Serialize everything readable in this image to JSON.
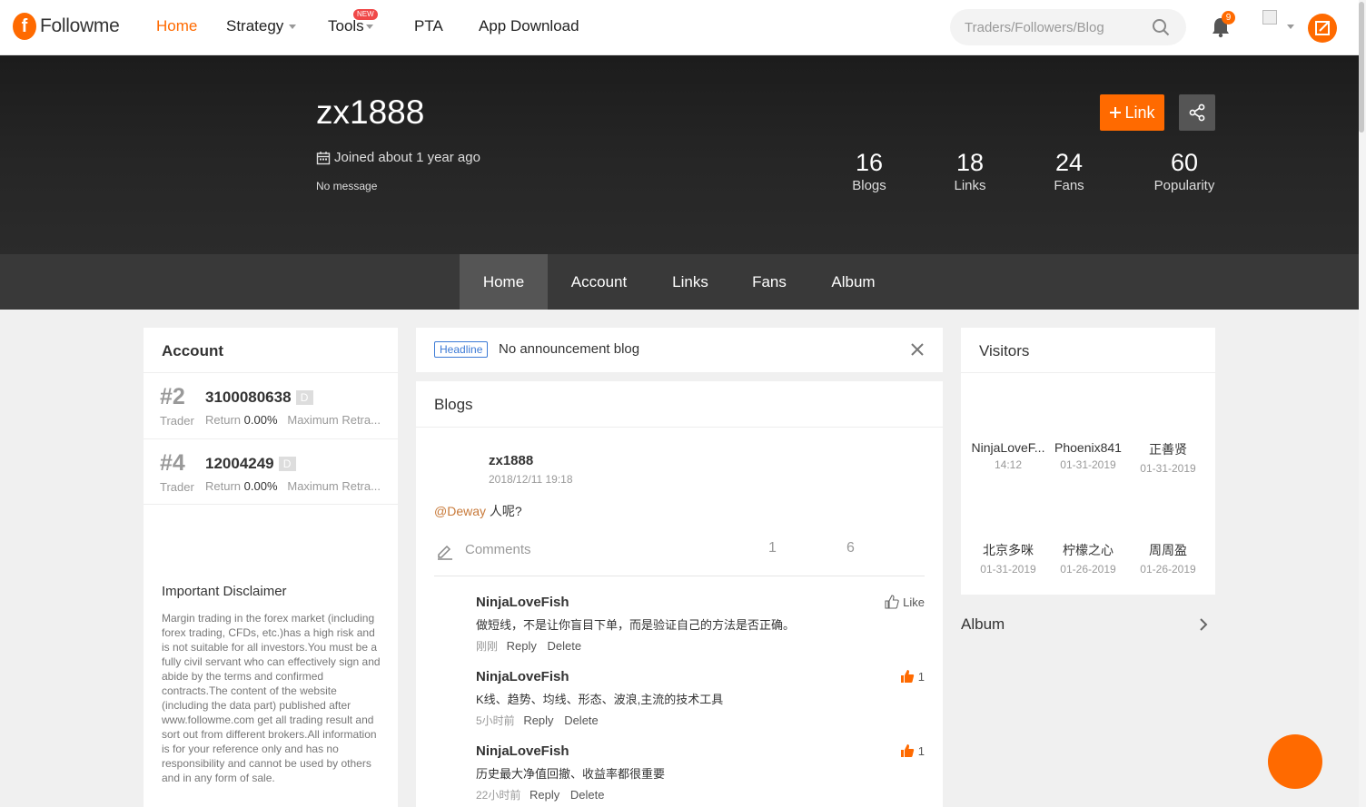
{
  "topnav": {
    "brand": "Followme",
    "logo_letter": "f",
    "items": [
      {
        "label": "Home",
        "active": true
      },
      {
        "label": "Strategy"
      },
      {
        "label": "Tools"
      },
      {
        "label": "PTA"
      },
      {
        "label": "App Download"
      }
    ],
    "tools_badge": "NEW",
    "search_placeholder": "Traders/Followers/Blog",
    "notification_count": "9",
    "accent_color": "#ff6a00"
  },
  "profile": {
    "username": "zx1888",
    "joined": "Joined about 1 year ago",
    "message": "No message",
    "link_button": "Link",
    "stats": [
      {
        "value": "16",
        "label": "Blogs"
      },
      {
        "value": "18",
        "label": "Links"
      },
      {
        "value": "24",
        "label": "Fans"
      },
      {
        "value": "60",
        "label": "Popularity"
      }
    ]
  },
  "tabs": [
    {
      "label": "Home",
      "active": true
    },
    {
      "label": "Account"
    },
    {
      "label": "Links"
    },
    {
      "label": "Fans"
    },
    {
      "label": "Album"
    }
  ],
  "account_panel": {
    "title": "Account",
    "accounts": [
      {
        "rank": "#2",
        "role": "Trader",
        "number": "3100080638",
        "badge": "D",
        "return_label": "Return",
        "return_value": "0.00%",
        "retra_label": "Maximum Retra..."
      },
      {
        "rank": "#4",
        "role": "Trader",
        "number": "12004249",
        "badge": "D",
        "return_label": "Return",
        "return_value": "0.00%",
        "retra_label": "Maximum Retra..."
      }
    ],
    "disclaimer_title": "Important Disclaimer",
    "disclaimer_text": "Margin trading in the forex market (including forex trading, CFDs, etc.)has a high risk and is not suitable for all investors.You must be a fully civil servant who can effectively sign and abide by the terms and confirmed contracts.The content of the website (including the data part) published after www.followme.com get all trading result and sort out from different brokers.All information is for your reference only and has no responsibility and cannot be used by others and in any form of sale."
  },
  "headline": {
    "tag": "Headline",
    "text": "No announcement blog"
  },
  "blogs": {
    "title": "Blogs",
    "post": {
      "author": "zx1888",
      "time": "2018/12/11 19:18",
      "mention": "@Deway",
      "body": " 人呢?",
      "comments_label": "Comments",
      "count_a": "1",
      "count_b": "6"
    },
    "comments": [
      {
        "name": "NinjaLoveFish",
        "text": "做短线，不是让你盲目下单，而是验证自己的方法是否正确。",
        "time": "刚刚",
        "reply": "Reply",
        "delete": "Delete",
        "like_label": "Like",
        "liked": false
      },
      {
        "name": "NinjaLoveFish",
        "text": "K线、趋势、均线、形态、波浪,主流的技术工具",
        "time": "5小时前",
        "reply": "Reply",
        "delete": "Delete",
        "like_label": "1",
        "liked": true
      },
      {
        "name": "NinjaLoveFish",
        "text": "历史最大净值回撤、收益率都很重要",
        "time": "22小时前",
        "reply": "Reply",
        "delete": "Delete",
        "like_label": "1",
        "liked": true
      }
    ]
  },
  "visitors": {
    "title": "Visitors",
    "items": [
      {
        "name": "NinjaLoveF...",
        "time": "14:12"
      },
      {
        "name": "Phoenix841",
        "time": "01-31-2019"
      },
      {
        "name": "正善贤",
        "time": "01-31-2019"
      },
      {
        "name": "北京多咪",
        "time": "01-31-2019"
      },
      {
        "name": "柠檬之心",
        "time": "01-26-2019"
      },
      {
        "name": "周周盈",
        "time": "01-26-2019"
      }
    ]
  },
  "album": {
    "label": "Album"
  }
}
